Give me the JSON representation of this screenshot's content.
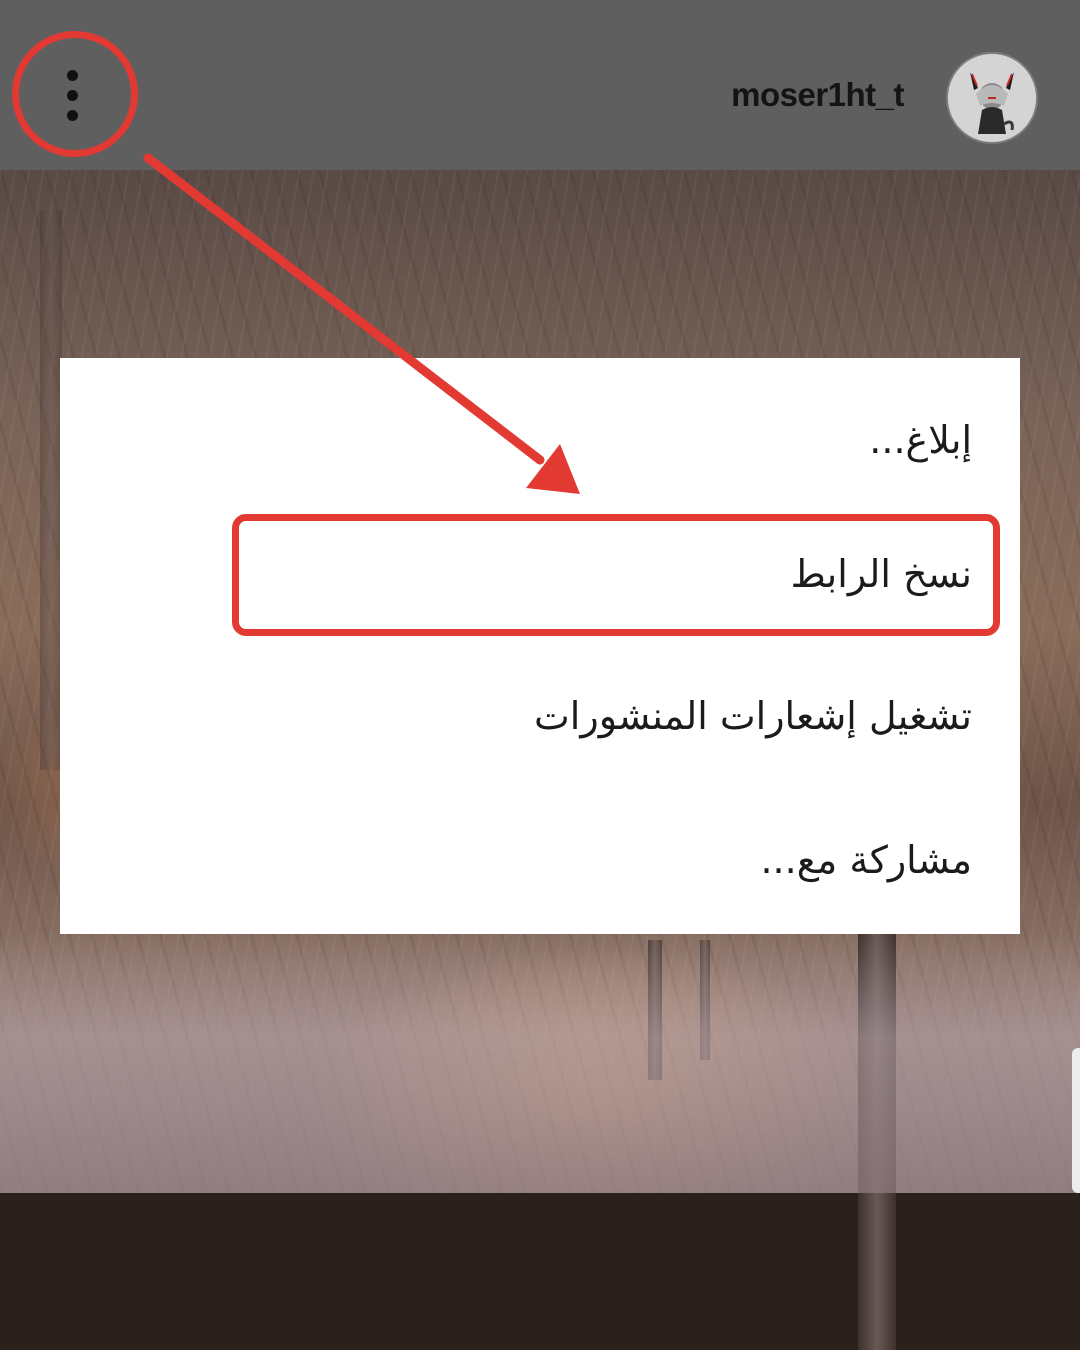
{
  "header": {
    "username": "moser1ht_t",
    "more_icon": "more-vertical-icon",
    "avatar_icon": "avatar-icon"
  },
  "menu": {
    "items": [
      {
        "label": "إبلاغ..."
      },
      {
        "label": "نسخ الرابط"
      },
      {
        "label": "تشغيل إشعارات المنشورات"
      },
      {
        "label": "مشاركة مع..."
      }
    ]
  },
  "annotation": {
    "color": "#e23a32",
    "highlighted_item": "نسخ الرابط"
  },
  "colors": {
    "header_bg": "#5f5f5f",
    "menu_bg": "#ffffff",
    "text": "#1b1b1b"
  }
}
